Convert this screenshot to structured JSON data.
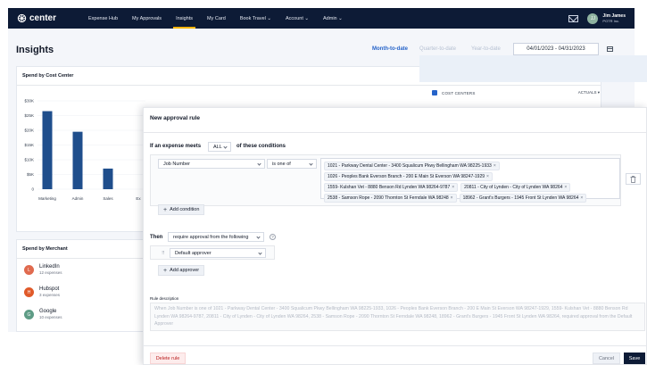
{
  "nav": {
    "logo": "center",
    "links": [
      "Expense Hub",
      "My Approvals",
      "Insights",
      "My Card",
      "Book Travel ⌄",
      "Account ⌄",
      "Admin ⌄"
    ],
    "active": "Insights",
    "user_initials": "JJ",
    "user_name": "Jim James",
    "user_org": "POTR Inc."
  },
  "page": {
    "title": "Insights",
    "periods": [
      "Month-to-date",
      "Quarter-to-date",
      "Year-to-date"
    ],
    "active_period": "Month-to-date",
    "date_range": "04/01/2023 - 04/31/2023"
  },
  "spend_cost_center": {
    "title": "Spend by Cost Center",
    "cost_centers_header": "COST CENTERS",
    "actuals_header": "ACTUALS"
  },
  "chart_data": {
    "type": "bar",
    "categories": [
      "Marketing",
      "Admin",
      "Sales",
      "Ex"
    ],
    "values": [
      26500,
      19500,
      7000,
      null
    ],
    "ylim": [
      0,
      30000
    ],
    "yticks": [
      "$30K",
      "$25K",
      "$20K",
      "$15K",
      "$10K",
      "$5K",
      "0"
    ],
    "bar_color": "#1f4e8c"
  },
  "spend_merchant": {
    "title": "Spend by Merchant",
    "items": [
      {
        "initial": "L",
        "name": "LinkedIn",
        "sub": "12 expenses",
        "color": "#e06a4e"
      },
      {
        "initial": "H",
        "name": "Hubspot",
        "sub": "3 expenses",
        "color": "#e05a2a"
      },
      {
        "initial": "G",
        "name": "Google",
        "sub": "10 expenses",
        "color": "#5e9c86"
      }
    ]
  },
  "modal": {
    "title": "New approval rule",
    "if_prefix": "If an expense meets",
    "match_value": "ALL",
    "if_suffix": "of these conditions",
    "field_value": "Job Number",
    "operator_value": "is one of",
    "tags": [
      "1021 - Parkway Dental Center - 3400 Squalicum Pkwy Bellingham WA 98225-1933",
      "1026 - Peoples Bank Everson Branch - 200 E Main St Everson WA 98247-1929",
      "1559- Kulshan Vet - 8880 Benson Rd Lynden WA 98264-9787",
      "20811 - City of Lynden - City of Lynden WA 98264",
      "2538 - Samson Rope - 2090 Thornton St Ferndale WA 98248",
      "18962 - Grant's Burgers - 1945 Front St Lynden WA 98264"
    ],
    "add_condition": "Add condition",
    "then_label": "Then",
    "then_value": "require approval from the following",
    "approver_value": "Default approver",
    "add_approver": "Add approver",
    "rule_description_label": "Rule description",
    "rule_description": "When Job Number is one of 1021 - Parkway Dental Center - 3400 Squalicum Pkwy Bellingham WA 98225-1933, 1026 - Peoples Bank Everson Branch - 200 E Main St Everson WA 98247-1929, 1559- Kulshan Vet - 8880 Benson Rd Lynden WA 98264-9787, 20811 - City of Lynden - City of Lynden WA 98264, 2538 - Samson Rope - 2090 Thornton St Ferndale WA 98248, 18962 - Grant's Burgers - 1945 Front St Lynden WA 98264, required approval from the Default Approver",
    "delete_label": "Delete rule",
    "cancel_label": "Cancel",
    "save_label": "Save"
  }
}
